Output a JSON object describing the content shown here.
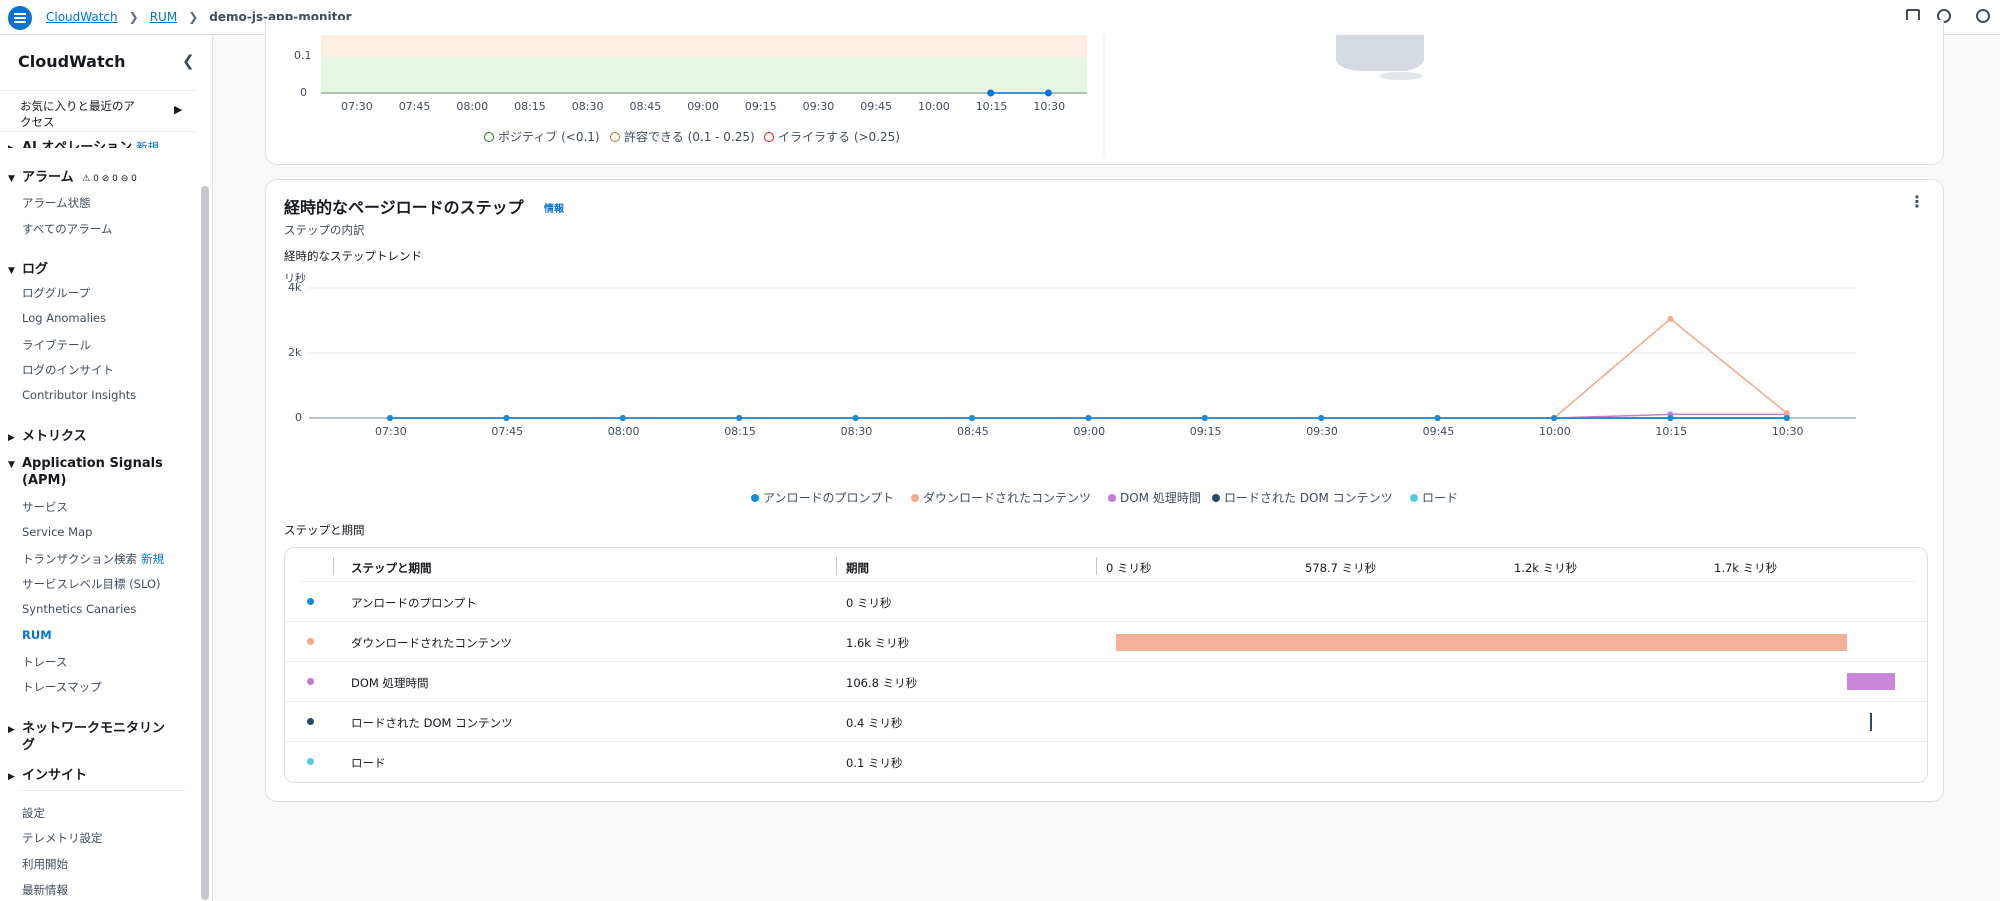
{
  "breadcrumb": {
    "cloudwatch": "CloudWatch",
    "rum": "RUM",
    "current": "demo-js-app-monitor"
  },
  "sidebar": {
    "title": "CloudWatch",
    "favorites": "お気に入りと最近のアクセス",
    "ai_ops": "AI オペレーション",
    "new": "新規",
    "alarms": "アラーム",
    "alarm_counts": [
      "0",
      "0",
      "0"
    ],
    "alarm_state": "アラーム状態",
    "all_alarms": "すべてのアラーム",
    "logs": "ログ",
    "log_groups": "ロググループ",
    "log_anomalies": "Log Anomalies",
    "live_tail": "ライブテール",
    "log_insights": "ログのインサイト",
    "contributor": "Contributor Insights",
    "metrics": "メトリクス",
    "app_signals_1": "Application Signals",
    "app_signals_2": "(APM)",
    "services": "サービス",
    "service_map": "Service Map",
    "tx_search": "トランザクション検索",
    "slo": "サービスレベル目標 (SLO)",
    "synthetics": "Synthetics Canaries",
    "rum": "RUM",
    "traces": "トレース",
    "trace_map": "トレースマップ",
    "network_1": "ネットワークモニタリン",
    "network_2": "グ",
    "insights": "インサイト",
    "settings": "設定",
    "telemetry": "テレメトリ設定",
    "getting_started": "利用開始",
    "whats_new": "最新情報"
  },
  "top_chart": {
    "y_ticks": [
      "0.1",
      "0"
    ],
    "x_ticks": [
      "07:30",
      "07:45",
      "08:00",
      "08:15",
      "08:30",
      "08:45",
      "09:00",
      "09:15",
      "09:30",
      "09:45",
      "10:00",
      "10:15",
      "10:30"
    ],
    "legend": [
      "ポジティブ (<0.1)",
      "許容できる (0.1 - 0.25)",
      "イライラする (>0.25)"
    ],
    "legend_colors": [
      "#037f0c",
      "#b8723d",
      "#d91515"
    ],
    "points": [
      [
        "10:15",
        0
      ],
      [
        "10:30",
        0
      ]
    ]
  },
  "steps": {
    "title": "経時的なページロードのステップ",
    "info": "情報",
    "subtitle": "ステップの内訳",
    "trend_title": "経時的なステップトレンド",
    "y_unit": "リ秒",
    "legend": [
      "アンロードのプロンプト",
      "ダウンロードされたコンテンツ",
      "DOM 処理時間",
      "ロードされた DOM コンテンツ",
      "ロード"
    ],
    "table_title": "ステップと期間",
    "table_headers": {
      "step": "ステップと期間",
      "duration": "期間"
    },
    "scale_ticks": [
      "0 ミリ秒",
      "578.7 ミリ秒",
      "1.2k ミリ秒",
      "1.7k ミリ秒"
    ],
    "rows": [
      {
        "name": "アンロードのプロンプト",
        "duration": "0 ミリ秒"
      },
      {
        "name": "ダウンロードされたコンテンツ",
        "duration": "1.6k ミリ秒"
      },
      {
        "name": "DOM 処理時間",
        "duration": "106.8 ミリ秒"
      },
      {
        "name": "ロードされた DOM コンテンツ",
        "duration": "0.4 ミリ秒"
      },
      {
        "name": "ロード",
        "duration": "0.1 ミリ秒"
      }
    ]
  },
  "chart_data": {
    "type": "line",
    "x": [
      "07:30",
      "07:45",
      "08:00",
      "08:15",
      "08:30",
      "08:45",
      "09:00",
      "09:15",
      "09:30",
      "09:45",
      "10:00",
      "10:15",
      "10:30"
    ],
    "ylabel": "リ秒",
    "y_ticks": [
      "4k",
      "2k",
      "0"
    ],
    "ylim": [
      0,
      4000
    ],
    "grid": true,
    "legend_position": "bottom",
    "colors": [
      "#0f8ed8",
      "#f4a98b",
      "#c07bd6",
      "#2c4a66",
      "#5ac8e0"
    ],
    "series": [
      {
        "name": "アンロードのプロンプト",
        "values": [
          0,
          0,
          0,
          0,
          0,
          0,
          0,
          0,
          0,
          0,
          0,
          0,
          0
        ]
      },
      {
        "name": "ダウンロードされたコンテンツ",
        "values": [
          0,
          0,
          0,
          0,
          0,
          0,
          0,
          0,
          0,
          0,
          0,
          3050,
          150
        ]
      },
      {
        "name": "DOM 処理時間",
        "values": [
          0,
          0,
          0,
          0,
          0,
          0,
          0,
          0,
          0,
          0,
          0,
          110,
          110
        ]
      },
      {
        "name": "ロードされた DOM コンテンツ",
        "values": [
          0,
          0,
          0,
          0,
          0,
          0,
          0,
          0,
          0,
          0,
          0,
          0,
          0
        ]
      },
      {
        "name": "ロード",
        "values": [
          0,
          0,
          0,
          0,
          0,
          0,
          0,
          0,
          0,
          0,
          0,
          0,
          0
        ]
      }
    ]
  }
}
